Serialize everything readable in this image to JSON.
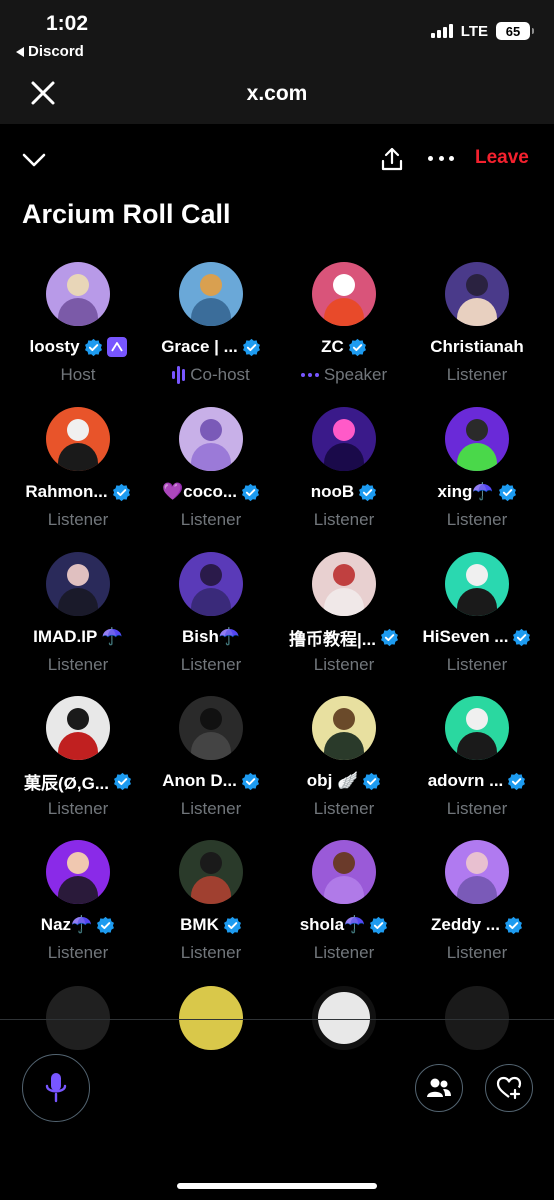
{
  "status_bar": {
    "time": "1:02",
    "back_app": "Discord",
    "network": "LTE",
    "battery": "65"
  },
  "browser": {
    "url": "x.com"
  },
  "space": {
    "title": "Arcium Roll Call",
    "leave_label": "Leave"
  },
  "colors": {
    "accent": "#7856ff",
    "verified": "#1d9bf0",
    "leave": "#f4212e",
    "muted": "#71767b"
  },
  "participants": [
    {
      "name": "loosty",
      "role": "Host",
      "verified": true
    },
    {
      "name": "Grace | ...",
      "role": "Co-host",
      "verified": true
    },
    {
      "name": "ZC",
      "role": "Speaker",
      "verified": true
    },
    {
      "name": "Christianah",
      "role": "Listener",
      "verified": false
    },
    {
      "name": "Rahmon...",
      "role": "Listener",
      "verified": true
    },
    {
      "name": "💜coco...",
      "role": "Listener",
      "verified": true
    },
    {
      "name": "nooB",
      "role": "Listener",
      "verified": true
    },
    {
      "name": "xing☂️",
      "role": "Listener",
      "verified": true
    },
    {
      "name": "IMAD.IP ☂️",
      "role": "Listener",
      "verified": false
    },
    {
      "name": "Bish☂️",
      "role": "Listener",
      "verified": false
    },
    {
      "name": "撸币教程|...",
      "role": "Listener",
      "verified": true
    },
    {
      "name": "HiSeven ...",
      "role": "Listener",
      "verified": true
    },
    {
      "name": "菓辰(Ø,G...",
      "role": "Listener",
      "verified": true
    },
    {
      "name": "Anon D...",
      "role": "Listener",
      "verified": true
    },
    {
      "name": "obj 🪽",
      "role": "Listener",
      "verified": true
    },
    {
      "name": "adovrn ...",
      "role": "Listener",
      "verified": true
    },
    {
      "name": "Naz☂️",
      "role": "Listener",
      "verified": true
    },
    {
      "name": "BMK",
      "role": "Listener",
      "verified": true
    },
    {
      "name": "shola☂️",
      "role": "Listener",
      "verified": true
    },
    {
      "name": "Zeddy ...",
      "role": "Listener",
      "verified": true
    }
  ],
  "icons": {
    "close": "close-icon",
    "collapse": "chevron-down-icon",
    "share": "share-icon",
    "more": "more-icon",
    "mic": "microphone-icon",
    "people": "people-icon",
    "reaction": "heart-plus-icon"
  }
}
